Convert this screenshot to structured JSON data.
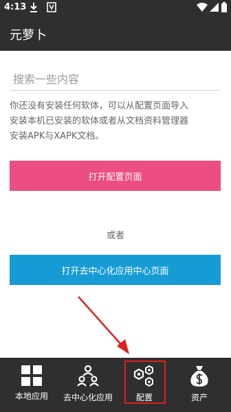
{
  "status_bar": {
    "time": "4:13"
  },
  "app_bar": {
    "title": "元萝卜"
  },
  "search": {
    "placeholder": "搜索一些内容"
  },
  "message": {
    "lines": [
      "你还没有安装任何软体，可以从配置页面导入",
      "安装本机已安装的软体或者从文档资料管理器",
      "安装APK与XAPK文档。"
    ]
  },
  "buttons": {
    "open_config": "打开配置页面",
    "or": "或者",
    "open_decentral": "打开去中心化应用中心页面"
  },
  "bottom_nav": {
    "items": [
      {
        "label": "本地应用",
        "icon": "grid-icon"
      },
      {
        "label": "去中心化应用",
        "icon": "people-icon"
      },
      {
        "label": "配置",
        "icon": "hexagon-nuts-icon"
      },
      {
        "label": "资产",
        "icon": "money-bag-icon"
      }
    ]
  },
  "colors": {
    "bar_bg": "#2f2f2f",
    "pink_button": "#ec4d83",
    "blue_button": "#169bd5",
    "annotation_red": "#e0201d"
  }
}
